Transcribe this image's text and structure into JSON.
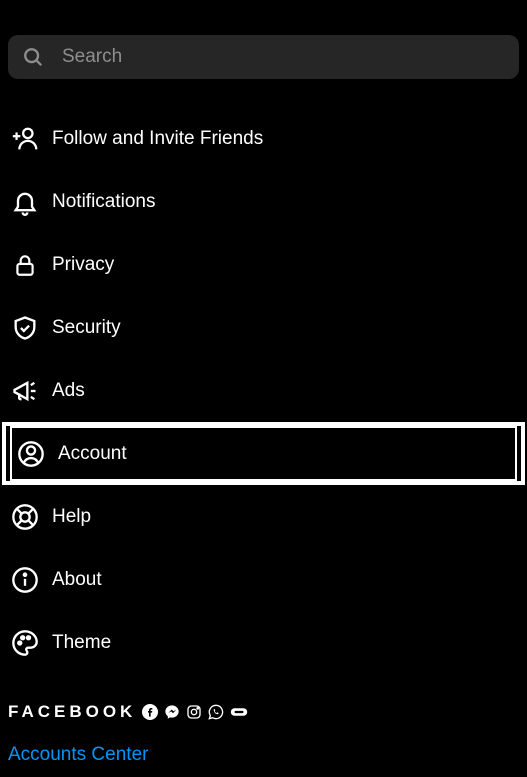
{
  "search": {
    "placeholder": "Search"
  },
  "menu": {
    "follow": "Follow and Invite Friends",
    "notifications": "Notifications",
    "privacy": "Privacy",
    "security": "Security",
    "ads": "Ads",
    "account": "Account",
    "help": "Help",
    "about": "About",
    "theme": "Theme"
  },
  "footer": {
    "brand": "FACEBOOK",
    "link": "Accounts Center"
  }
}
